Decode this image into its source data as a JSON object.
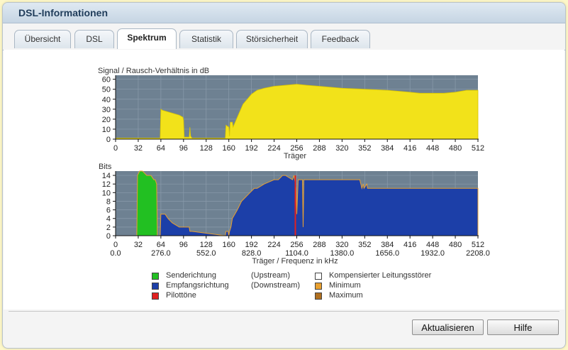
{
  "window": {
    "title": "DSL-Informationen"
  },
  "tabs": [
    {
      "label": "Übersicht",
      "active": false
    },
    {
      "label": "DSL",
      "active": false
    },
    {
      "label": "Spektrum",
      "active": true
    },
    {
      "label": "Statistik",
      "active": false
    },
    {
      "label": "Störsicherheit",
      "active": false
    },
    {
      "label": "Feedback",
      "active": false
    }
  ],
  "charts": {
    "snr": {
      "ylabel": "Signal / Rausch-Verhältnis in dB",
      "xlabel": "Träger",
      "y_ticks": [
        "0",
        "10",
        "20",
        "30",
        "40",
        "50",
        "60"
      ],
      "x_ticks": [
        "0",
        "32",
        "64",
        "96",
        "128",
        "160",
        "192",
        "224",
        "256",
        "288",
        "320",
        "352",
        "384",
        "416",
        "448",
        "480",
        "512"
      ]
    },
    "bits": {
      "ylabel": "Bits",
      "xlabel": "Träger / Frequenz in kHz",
      "y_ticks": [
        "0",
        "2",
        "4",
        "6",
        "8",
        "10",
        "12",
        "14"
      ],
      "x_ticks": [
        "0",
        "32",
        "64",
        "96",
        "128",
        "160",
        "192",
        "224",
        "256",
        "288",
        "320",
        "352",
        "384",
        "416",
        "448",
        "480",
        "512"
      ],
      "freq_ticks": [
        "0.0",
        "276.0",
        "552.0",
        "828.0",
        "1104.0",
        "1380.0",
        "1656.0",
        "1932.0",
        "2208.0"
      ]
    }
  },
  "chart_data": [
    {
      "type": "area",
      "ylabel": "Signal / Rausch-Verhältnis in dB",
      "xlabel": "Träger",
      "xlim": [
        0,
        512
      ],
      "ylim": [
        0,
        64
      ],
      "grid": true,
      "colors": {
        "fill": "#f2e21a",
        "background": "#6e8192",
        "grid": "#8496a6"
      },
      "series": [
        {
          "x": [
            0,
            63,
            64,
            66,
            90,
            95,
            96,
            97,
            100,
            104,
            105,
            106,
            108,
            155,
            156,
            160,
            161,
            162,
            165,
            166,
            172,
            180,
            192,
            200,
            210,
            224,
            240,
            256,
            270,
            288,
            320,
            352,
            384,
            400,
            416,
            430,
            448,
            464,
            480,
            496,
            512
          ],
          "y": [
            1,
            1,
            30,
            29,
            24,
            22,
            19,
            2,
            2,
            2,
            12,
            3,
            1,
            1,
            14,
            12,
            3,
            17,
            17,
            12,
            22,
            35,
            45,
            49,
            51,
            53,
            54,
            55,
            54,
            53,
            51,
            50,
            49,
            48,
            47,
            46,
            46,
            46,
            47,
            49,
            49
          ]
        }
      ]
    },
    {
      "type": "area",
      "ylabel": "Bits",
      "xlabel": "Träger / Frequenz in kHz",
      "xlim": [
        0,
        512
      ],
      "ylim": [
        0,
        15
      ],
      "grid": true,
      "colors": {
        "upstream": "#22c022",
        "downstream": "#1c3fa8",
        "pilot": "#e02020",
        "min": "#e8a030",
        "max": "#b07020"
      },
      "series": [
        {
          "name": "Senderichtung",
          "x": [
            30,
            31,
            34,
            38,
            44,
            50,
            54,
            56,
            58,
            59
          ],
          "y": [
            0,
            14,
            15,
            15,
            14,
            14,
            13,
            13,
            12,
            0
          ]
        },
        {
          "name": "Empfangsrichtung",
          "x": [
            63,
            64,
            66,
            70,
            74,
            80,
            90,
            100,
            104,
            105,
            106,
            108,
            155,
            156,
            159,
            160,
            161,
            163,
            165,
            172,
            178,
            184,
            190,
            196,
            200,
            210,
            224,
            230,
            236,
            240,
            250,
            252,
            253,
            255,
            256,
            258,
            262,
            264,
            265,
            266,
            267,
            270,
            288,
            300,
            320,
            345,
            348,
            350,
            351,
            355,
            356,
            360,
            384,
            416,
            448,
            480,
            512
          ],
          "y": [
            0,
            5,
            5,
            5,
            4,
            3,
            2,
            2,
            2,
            1,
            1,
            1,
            0,
            1,
            1,
            0,
            1,
            2,
            4,
            6,
            8,
            9,
            10,
            11,
            11,
            12,
            13,
            13,
            14,
            14,
            13,
            14,
            13,
            11,
            5,
            13,
            13,
            13,
            2,
            13,
            13,
            13,
            13,
            13,
            13,
            13,
            11,
            12,
            11,
            12,
            11,
            11,
            11,
            11,
            11,
            11,
            11
          ]
        },
        {
          "name": "Pilottöne",
          "x": [
            253,
            254
          ],
          "y": [
            14,
            14
          ]
        }
      ]
    }
  ],
  "legend": [
    {
      "label": "Senderichtung",
      "dir": "(Upstream)",
      "color": "#22c022"
    },
    {
      "label": "Empfangsrichtung",
      "dir": "(Downstream)",
      "color": "#1c3fa8"
    },
    {
      "label": "Pilottöne",
      "dir": "",
      "color": "#e02020"
    },
    {
      "label": "Kompensierter Leitungsstörer",
      "color": "#ffffff"
    },
    {
      "label": "Minimum",
      "color": "#e8a030"
    },
    {
      "label": "Maximum",
      "color": "#b07020"
    }
  ],
  "buttons": {
    "refresh": "Aktualisieren",
    "help": "Hilfe"
  }
}
